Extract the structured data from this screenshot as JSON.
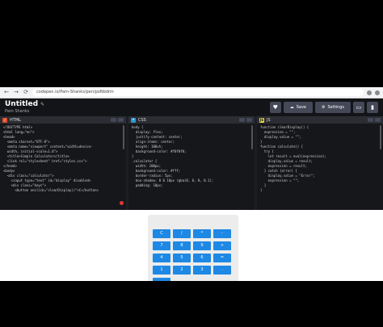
{
  "browser": {
    "url": "codepen.io/Pam-Shanks/pen/poNbdrm",
    "back": "←",
    "forward": "→",
    "reload": "⟳"
  },
  "header": {
    "title": "Untitled",
    "pencil": "✎",
    "author": "Pam Shanks",
    "like_icon": "♥",
    "save_label": "Save",
    "settings_label": "Settings",
    "layout_icon": "▭",
    "user_icon": "▮"
  },
  "panels": {
    "html": {
      "label": "HTML",
      "badge": "/",
      "lines": [
        "<!DOCTYPE html>",
        "<html lang=\"en\">",
        "<head>",
        "  <meta charset=\"UTF-8\">",
        "  <meta name=\"viewport\" content=\"width=device-",
        "  width, initial-scale=1.0\">",
        "  <title>Simple Calculator</title>",
        "  <link rel=\"stylesheet\" href=\"styles.css\">",
        "</head>",
        "<body>",
        "  <div class=\"calculator\">",
        "    <input type=\"text\" id=\"display\" disabled>",
        "    <div class=\"keys\">",
        "      <button onclick=\"clearDisplay()\">C</button>"
      ]
    },
    "css": {
      "label": "CSS",
      "badge": "*",
      "lines": [
        "body {",
        "  display: flex;",
        "  justify-content: center;",
        "  align-items: center;",
        "  height: 100vh;",
        "  background-color: #f0f0f0;",
        "}",
        "",
        "",
        "",
        "",
        "",
        ".calculator {",
        "  width: 200px;",
        "  background-color: #fff;",
        "  border-radius: 5px;",
        "  box-shadow: 0 0 10px rgba(0, 0, 0, 0.1);",
        "  padding: 10px;"
      ]
    },
    "js": {
      "label": "JS",
      "badge": "JS",
      "lines": [
        "function clearDisplay() {",
        "  expression = \"\";",
        "  display.value = \"\";",
        "}",
        "",
        "",
        "",
        "function calculate() {",
        "  try {",
        "    let result = eval(expression);",
        "    display.value = result;",
        "    expression = result;",
        "  } catch (error) {",
        "    display.value = \"Error\";",
        "    expression = \"\";",
        "  }",
        "}"
      ]
    }
  },
  "calculator": {
    "keys": [
      "C",
      "/",
      "*",
      "-",
      "7",
      "8",
      "9",
      "+",
      "4",
      "5",
      "6",
      "=",
      "1",
      "2",
      "3",
      "."
    ]
  },
  "colors": {
    "header_bg": "#131417",
    "editor_bg": "#16171b",
    "button_blue": "#1e88e5",
    "html_badge": "#e44d26",
    "css_badge": "#2f97d4",
    "js_badge": "#f0db4f"
  }
}
